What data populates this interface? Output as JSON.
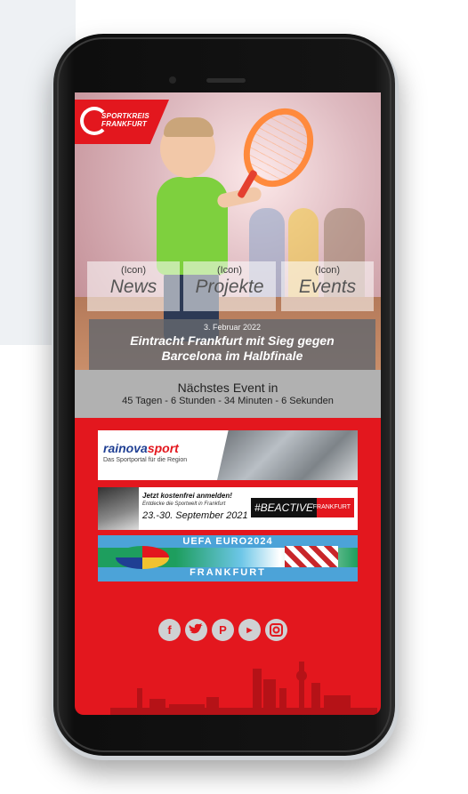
{
  "logo": {
    "line1": "SPORTKREIS",
    "line2": "FRANKFURT"
  },
  "tiles": [
    {
      "icon": "(Icon)",
      "label": "News"
    },
    {
      "icon": "(Icon)",
      "label": "Projekte"
    },
    {
      "icon": "(Icon)",
      "label": "Events"
    }
  ],
  "news": {
    "date": "3. Februar 2022",
    "title_line1": "Eintracht Frankfurt mit Sieg gegen",
    "title_line2": "Barcelona im Halbfinale"
  },
  "event": {
    "title": "Nächstes Event in",
    "countdown": "45 Tagen - 6 Stunden - 34 Minuten - 6 Sekunden"
  },
  "banners": {
    "b1": {
      "brand_a": "rainova",
      "brand_b": "sport",
      "subtitle": "Das Sportportal für die Region"
    },
    "b2": {
      "line1": "Jetzt kostenfrei anmelden!",
      "line2": "Entdecke die Sportwelt in Frankfurt",
      "dates": "23.-30. September 2021",
      "hashtag": "#BEACTIVE",
      "city": "FRANKFURT"
    },
    "b3": {
      "title": "UEFA EURO2024",
      "city": "FRANKFURT"
    }
  },
  "social": [
    "facebook",
    "twitter",
    "pinterest",
    "youtube",
    "instagram"
  ],
  "colors": {
    "brand_red": "#e3171e",
    "event_gray": "#b1b1b1",
    "tile_bg": "rgba(255,255,255,0.55)"
  }
}
